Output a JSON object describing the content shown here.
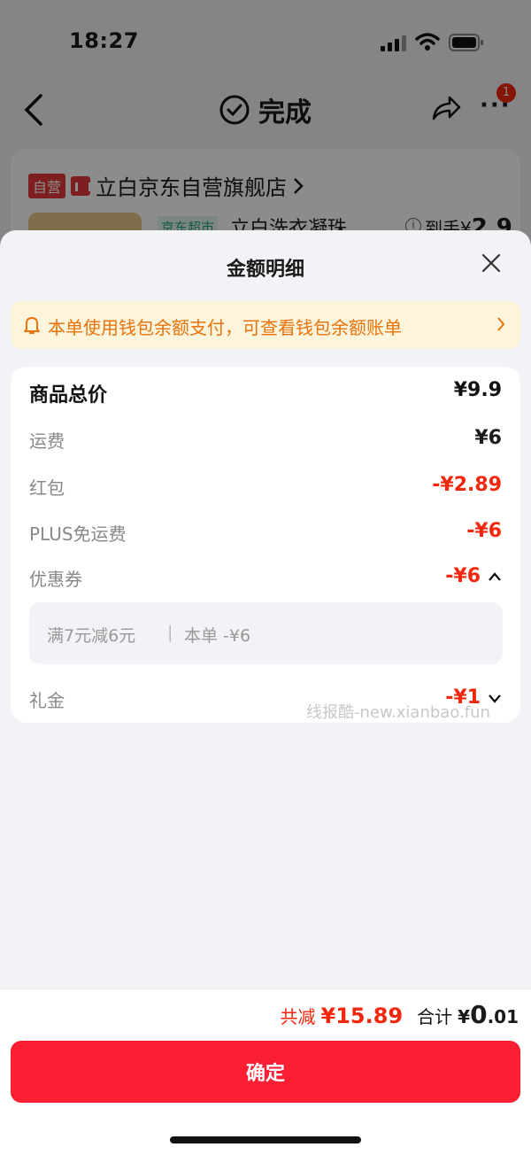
{
  "status": {
    "time": "18:27"
  },
  "nav": {
    "title": "完成",
    "badge": "1",
    "more": "···"
  },
  "order": {
    "shop_tag": "自营",
    "shop_name": "立白京东自营旗舰店",
    "supermarket_tag": "京东超市",
    "product_name": "立白洗衣凝珠 ...",
    "daoshou_label": "到手¥",
    "daoshou_value": "2.9"
  },
  "sheet": {
    "title": "金额明细",
    "notice": "本单使用钱包余额支付，可查看钱包余额账单",
    "rows": [
      {
        "label": "商品总价",
        "value": "¥9.9"
      },
      {
        "label": "运费",
        "value": "¥6"
      },
      {
        "label": "红包",
        "value": "-¥2.89"
      },
      {
        "label": "PLUS免运费",
        "value": "-¥6"
      },
      {
        "label": "优惠券",
        "value": "-¥6"
      },
      {
        "label": "礼金",
        "value": "-¥1"
      }
    ],
    "coupon_detail": {
      "rule": "满7元减6元",
      "sep": "|",
      "amount": "本单 -¥6"
    },
    "watermark": "线报酷-new.xianbao.fun"
  },
  "footer": {
    "reduce_label": "共减",
    "reduce_value": "¥15.89",
    "total_label": "合计",
    "total_yen": "¥",
    "total_int": "0",
    "total_dec": ".01",
    "confirm": "确定"
  },
  "colors": {
    "accent": "#fa1e32",
    "red_text": "#f2270c",
    "notice_text": "#e8730c",
    "notice_bg": "#fdf4dc"
  }
}
